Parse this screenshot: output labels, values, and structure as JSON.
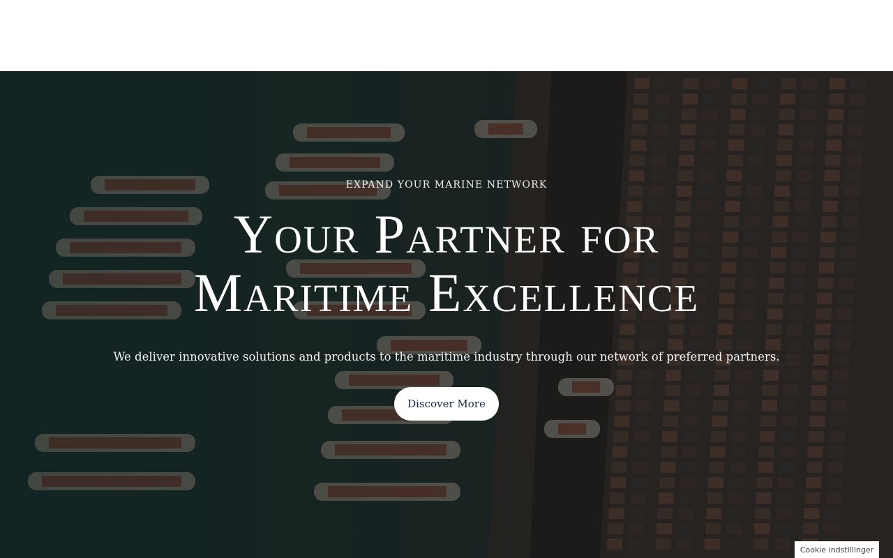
{
  "hero": {
    "eyebrow": "EXPAND YOUR MARINE NETWORK",
    "headline_line1": "Your Partner for",
    "headline_line2": "Maritime Excellence",
    "subtext": "We deliver innovative solutions and products to the maritime industry through our network of preferred partners.",
    "cta_label": "Discover More",
    "background_image": "aerial-container-port"
  },
  "cookie": {
    "label": "Cookie indstillinger"
  },
  "colors": {
    "cta_text": "#14274a",
    "hero_overlay": "#0a1214"
  }
}
